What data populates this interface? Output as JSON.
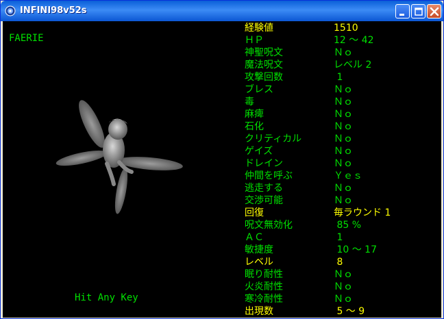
{
  "window": {
    "title": "INFINI98v52s",
    "controls": {
      "minimize": "minimize",
      "maximize": "maximize",
      "close": "close"
    }
  },
  "monster": {
    "name": "FAERIE",
    "prompt": "Hit Any Key"
  },
  "colors": {
    "text_green": "#00e000",
    "text_yellow": "#ffff00",
    "background": "#000000"
  },
  "stats": [
    {
      "label": "経験値",
      "value": "1510",
      "yellow": true
    },
    {
      "label": "ＨＰ",
      "value": "12 ～ 42",
      "yellow": false
    },
    {
      "label": "神聖呪文",
      "value": "Ｎｏ",
      "yellow": false
    },
    {
      "label": "魔法呪文",
      "value": "レベル 2",
      "yellow": false
    },
    {
      "label": "攻撃回数",
      "value": " 1",
      "yellow": false
    },
    {
      "label": "ブレス",
      "value": "Ｎｏ",
      "yellow": false
    },
    {
      "label": "毒",
      "value": "Ｎｏ",
      "yellow": false
    },
    {
      "label": "麻痺",
      "value": "Ｎｏ",
      "yellow": false
    },
    {
      "label": "石化",
      "value": "Ｎｏ",
      "yellow": false
    },
    {
      "label": "クリティカル",
      "value": "Ｎｏ",
      "yellow": false
    },
    {
      "label": "ゲイズ",
      "value": "Ｎｏ",
      "yellow": false
    },
    {
      "label": "ドレイン",
      "value": "Ｎｏ",
      "yellow": false
    },
    {
      "label": "仲間を呼ぶ",
      "value": "Ｙｅｓ",
      "yellow": false
    },
    {
      "label": "逃走する",
      "value": "Ｎｏ",
      "yellow": false
    },
    {
      "label": "交渉可能",
      "value": "Ｎｏ",
      "yellow": false
    },
    {
      "label": "回復",
      "value": "毎ラウンド 1",
      "yellow": true
    },
    {
      "label": "呪文無効化",
      "value": " 85 %",
      "yellow": false
    },
    {
      "label": "ＡＣ",
      "value": " 1",
      "yellow": false
    },
    {
      "label": "敏捷度",
      "value": " 10 ～ 17",
      "yellow": false
    },
    {
      "label": "レベル",
      "value": " 8",
      "yellow": true
    },
    {
      "label": "眠り耐性",
      "value": "Ｎｏ",
      "yellow": false
    },
    {
      "label": "火炎耐性",
      "value": "Ｎｏ",
      "yellow": false
    },
    {
      "label": "寒冷耐性",
      "value": "Ｎｏ",
      "yellow": false
    },
    {
      "label": "出現数",
      "value": " 5 ～ 9",
      "yellow": true
    }
  ]
}
